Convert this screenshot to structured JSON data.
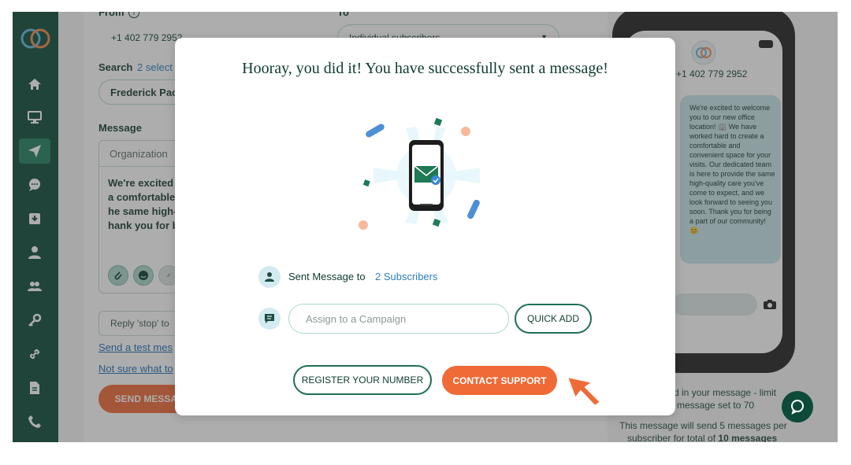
{
  "background": {
    "from_label": "From",
    "to_label": "To",
    "from_number": "+1 402 779 2952",
    "to_select": "Individual subscribers",
    "search_label": "Search",
    "search_selected": "2 select",
    "search_chip": "Frederick Pac",
    "message_label": "Message",
    "org_placeholder": "Organization",
    "message_lines": [
      "We're excited",
      "a comfortable",
      "he same high-",
      "hank you for b"
    ],
    "reply_stop": "Reply 'stop' to",
    "send_test_link": "Send a test mes",
    "not_sure_link": "Not sure what to",
    "send_message_button": "SEND MESSAG",
    "phone_number": "+1 402 779 2952",
    "phone_message": "We're excited to welcome you to our new office location! 🏢 We have worked hard to create a comfortable and convenient space for your visits. Our dedicated team is here to provide the same high-quality care you've come to expect, and we look forward to seeing you soon. Thank you for being a part of our community! 😊",
    "limit_note_1": "ted in your message - limit",
    "limit_note_2": "message set to 70",
    "send_note_1": "This message will send 5 messages per",
    "send_note_2_prefix": "subscriber for total of",
    "send_note_2_bold": "10 messages"
  },
  "modal": {
    "title": "Hooray, you did it! You have successfully sent a message!",
    "sent_label": "Sent Message to",
    "sent_value": "2 Subscribers",
    "campaign_placeholder": "Assign to a Campaign",
    "quick_add": "QUICK ADD",
    "register_number": "REGISTER YOUR NUMBER",
    "contact_support": "CONTACT SUPPORT"
  },
  "colors": {
    "brand_dark": "#0e4a3a",
    "accent_orange": "#ef6a36",
    "link_blue": "#2b7fc0"
  },
  "icons": {
    "sidebar": [
      "home-icon",
      "desktop-icon",
      "send-icon",
      "chat-icon",
      "inbox-icon",
      "user-icon",
      "users-icon",
      "key-icon",
      "link-icon",
      "document-icon",
      "phone-icon"
    ],
    "modal": [
      "user-icon",
      "message-icon",
      "phone-envelope-illustration",
      "arrow-pointer-icon"
    ]
  }
}
